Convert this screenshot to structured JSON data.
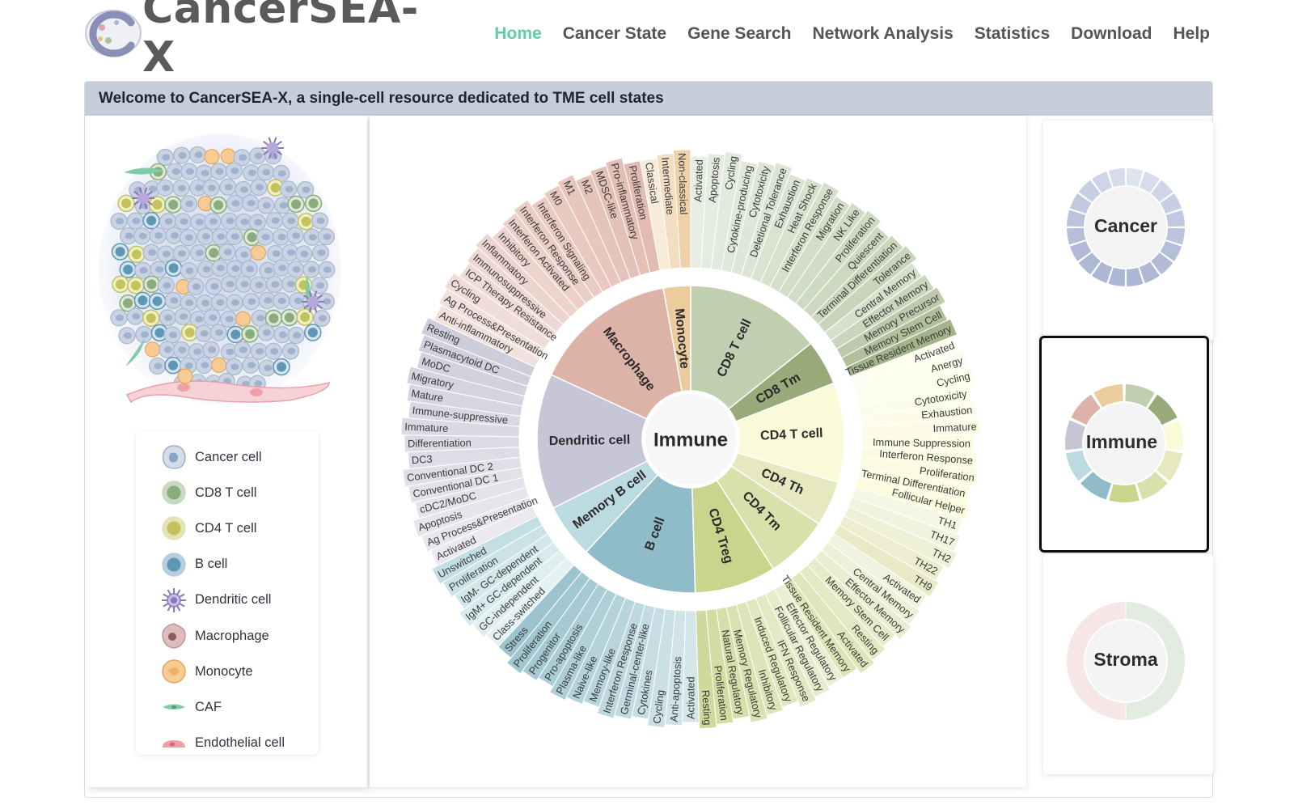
{
  "header": {
    "brand": "CancerSEA-X",
    "nav": [
      {
        "label": "Home",
        "active": true
      },
      {
        "label": "Cancer State",
        "active": false
      },
      {
        "label": "Gene Search",
        "active": false
      },
      {
        "label": "Network Analysis",
        "active": false
      },
      {
        "label": "Statistics",
        "active": false
      },
      {
        "label": "Download",
        "active": false
      },
      {
        "label": "Help",
        "active": false
      }
    ]
  },
  "welcome": "Welcome to CancerSEA-X, a single-cell resource dedicated to TME cell states",
  "legend": [
    {
      "label": "Cancer cell",
      "icon": "cancer-cell-icon",
      "color": "#b9c6dc"
    },
    {
      "label": "CD8 T cell",
      "icon": "cd8-t-cell-icon",
      "color": "#8aab7c"
    },
    {
      "label": "CD4 T cell",
      "icon": "cd4-t-cell-icon",
      "color": "#c4c25a"
    },
    {
      "label": "B cell",
      "icon": "b-cell-icon",
      "color": "#5e97b3"
    },
    {
      "label": "Dendritic cell",
      "icon": "dendritic-cell-icon",
      "color": "#8a78b8"
    },
    {
      "label": "Macrophage",
      "icon": "macrophage-icon",
      "color": "#c49596"
    },
    {
      "label": "Monocyte",
      "icon": "monocyte-icon",
      "color": "#efb06a"
    },
    {
      "label": "CAF",
      "icon": "caf-icon",
      "color": "#7ecba8"
    },
    {
      "label": "Endothelial cell",
      "icon": "endothelial-cell-icon",
      "color": "#f0a0a5"
    }
  ],
  "wheel": {
    "center_label": "Immune",
    "cell_types": [
      {
        "name": "CD8 T cell",
        "color": "#c1cfb1",
        "states": [
          "Activated",
          "Apoptosis",
          "Cycling",
          "Cytokine-producing",
          "Cytotoxicity",
          "Deletional Tolerance",
          "Exhaustion",
          "Heat Shock",
          "Interferon Response",
          "Migration",
          "NK Like",
          "Proliferation",
          "Quiescent",
          "Terminal Differentiation",
          "Tolerance"
        ]
      },
      {
        "name": "CD8 Tm",
        "color": "#98aa7a",
        "states": [
          "Central Memory",
          "Effector Memory",
          "Memory Precursor",
          "Memory Stem Cell",
          "Tissue Resident Memory"
        ]
      },
      {
        "name": "CD4 T cell",
        "color": "#fafad8",
        "states": [
          "Activated",
          "Anergy",
          "Cycling",
          "Cytotoxicity",
          "Exhaustion",
          "Immature",
          "Immune Suppression",
          "Interferon Response",
          "Proliferation",
          "Terminal Differentiation",
          "Follicular Helper"
        ]
      },
      {
        "name": "CD4 Th",
        "color": "#e6e8c0",
        "states": [
          "TH1",
          "TH17",
          "TH2",
          "TH22",
          "TH9"
        ]
      },
      {
        "name": "CD4 Tm",
        "color": "#d8e0ab",
        "states": [
          "Activated",
          "Central Memory",
          "Effector Memory",
          "Memory Stem Cell",
          "Resting",
          "Activated",
          "Tissue Resident Memory"
        ]
      },
      {
        "name": "CD4 Treg",
        "color": "#c9d48d",
        "states": [
          "Effector Regulatory",
          "Follicular Regulatory",
          "IFN Response",
          "Induced Regulatory",
          "Inhibitory",
          "Memory Regulatory",
          "Natural Regulatory",
          "Proliferation",
          "Resting"
        ]
      },
      {
        "name": "B cell",
        "color": "#8fbcc8",
        "states": [
          "Activated",
          "Anti-apoptosis",
          "Cycling",
          "Cytokines",
          "Germinal-center-like",
          "Interferon Response",
          "Memory-like",
          "Naive-like",
          "Plasma-like",
          "Pro-apoptosis",
          "Progenitor",
          "Proliferation",
          "Stress"
        ]
      },
      {
        "name": "Memory B cell",
        "color": "#bcdbe0",
        "states": [
          "Class-switched",
          "GC-independent",
          "IgM+ GC-dependent",
          "IgM- GC-dependent",
          "Proliferation",
          "Unswitched"
        ]
      },
      {
        "name": "Dendritic cell",
        "color": "#c7c6d6",
        "states": [
          "Activated",
          "Ag Process&Presentation",
          "Apoptosis",
          "cDC2/MoDC",
          "Conventional DC 1",
          "Conventional DC 2",
          "DC3",
          "Differentiation",
          "Immature",
          "Immune-suppressive",
          "Mature",
          "Migratory",
          "MoDC",
          "Plasmacytoid DC",
          "Resting"
        ]
      },
      {
        "name": "Macrophage",
        "color": "#deb3a7",
        "states": [
          "Anti-inflammatory",
          "Ag Process&Presentation",
          "Cycling",
          "ICP Therapy Resistance",
          "Immunosuppressive",
          "Inflammatory",
          "Inhibitory",
          "Interferon Activated",
          "Interferon Response",
          "Interferon Signaling",
          "M0",
          "M1",
          "M2",
          "MDSC-like",
          "Pro-inflammatory",
          "Proliferation"
        ]
      },
      {
        "name": "Monocyte",
        "color": "#eccb9d",
        "states": [
          "Classical",
          "Intermediate",
          "Non-classical"
        ]
      }
    ]
  },
  "side_cards": [
    {
      "label": "Cancer",
      "selected": false
    },
    {
      "label": "Immune",
      "selected": true
    },
    {
      "label": "Stroma",
      "selected": false
    }
  ]
}
